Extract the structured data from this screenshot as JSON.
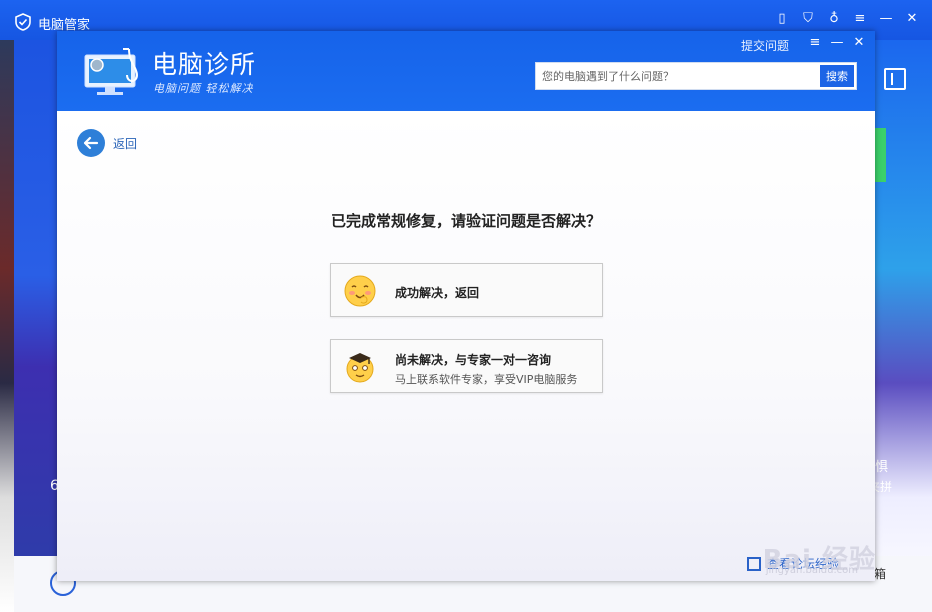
{
  "outer_window": {
    "title": "电脑管家",
    "left_partial_text": "6",
    "right_text_1": "惧",
    "right_text_2": "夹拼",
    "bottom_right_text": "箱"
  },
  "dialog": {
    "logo_title": "电脑诊所",
    "logo_subtitle": "电脑问题 轻松解决",
    "submit_link": "提交问题",
    "search": {
      "placeholder": "您的电脑遇到了什么问题？",
      "button_label": "搜索"
    },
    "back_label": "返回",
    "question": "已完成常规修复，请验证问题是否解决？",
    "options": [
      {
        "label": "成功解决，返回",
        "sub": ""
      },
      {
        "label": "尚未解决，与专家一对一咨询",
        "sub": "马上联系软件专家，享受VIP电脑服务"
      }
    ],
    "footer_link": "查看论坛经验"
  },
  "watermark": {
    "text": "Bai 经验",
    "sub": "jingyan.baidu.com"
  },
  "colors": {
    "header_blue": "#1663ea",
    "accent_blue": "#2e7fd8",
    "search_button": "#1c64e6"
  }
}
